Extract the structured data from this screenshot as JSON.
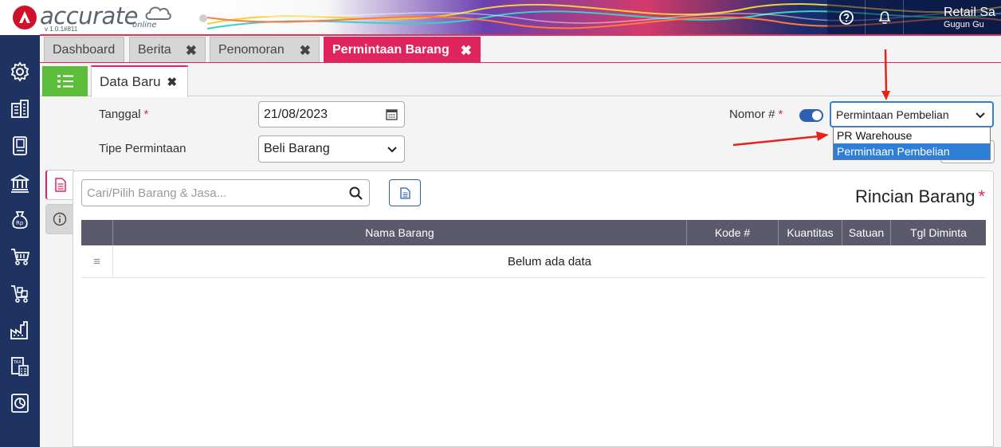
{
  "header": {
    "logo_text": "accurate",
    "logo_online": "online",
    "version": "v 1.0.1#811",
    "company_name": "Retail Sa",
    "user_name": "Gugun Gu",
    "help_icon": "question-circle-icon",
    "notification_icon": "bell-icon"
  },
  "sidebar": {
    "items": [
      {
        "icon": "gear-icon"
      },
      {
        "icon": "building-icon"
      },
      {
        "icon": "book-icon"
      },
      {
        "icon": "bank-icon"
      },
      {
        "icon": "money-bag-icon"
      },
      {
        "icon": "cart-icon"
      },
      {
        "icon": "cart-stock-icon"
      },
      {
        "icon": "factory-icon"
      },
      {
        "icon": "tax-calculator-icon"
      },
      {
        "icon": "report-chart-icon"
      }
    ]
  },
  "tabs": [
    {
      "label": "Dashboard",
      "closable": false
    },
    {
      "label": "Berita",
      "closable": true
    },
    {
      "label": "Penomoran",
      "closable": true
    },
    {
      "label": "Permintaan Barang",
      "closable": true,
      "active": true
    }
  ],
  "subtabs": {
    "list_icon": "list-icon",
    "current": "Data Baru"
  },
  "form": {
    "tanggal_label": "Tanggal",
    "tanggal_value": "21/08/2023",
    "tipe_label": "Tipe Permintaan",
    "tipe_value": "Beli Barang",
    "nomor_label": "Nomor #",
    "nomor_toggle_on": true,
    "nomor_select_value": "Permintaan Pembelian",
    "nomor_options": [
      "PR Warehouse",
      "Permintaan Pembelian"
    ],
    "nomor_selected_option": "Permintaan Pembelian",
    "required_mark": "*"
  },
  "detail": {
    "search_placeholder": "Cari/Pilih Barang & Jasa...",
    "title": "Rincian Barang",
    "columns": [
      "Nama Barang",
      "Kode #",
      "Kuantitas",
      "Satuan",
      "Tgl Diminta"
    ],
    "empty_text": "Belum ada data"
  },
  "colors": {
    "accent": "#e0245e",
    "sidebar": "#1e3361",
    "green": "#5bbd3a",
    "toggle": "#2d5fb3",
    "annotation_arrow": "#e8221b"
  }
}
